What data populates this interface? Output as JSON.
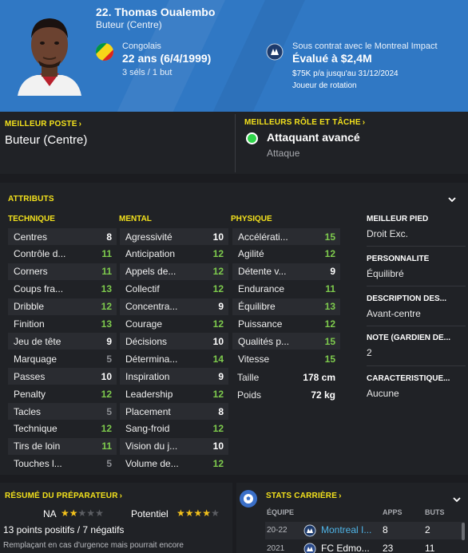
{
  "header": {
    "name": "22. Thomas Oualembo",
    "position": "Buteur (Centre)",
    "nationality": "Congolais",
    "age": "22 ans",
    "dob": "(6/4/1999)",
    "caps": "3 séls / 1 but",
    "contract": "Sous contrat avec le Montreal Impact",
    "value": "Évalué à $2,4M",
    "wage": "$75K p/a jusqu'au 31/12/2024",
    "squad_status": "Joueur de rotation"
  },
  "best_position": {
    "title": "MEILLEUR POSTE",
    "value": "Buteur (Centre)"
  },
  "best_role": {
    "title": "MEILLEURS RÔLE ET TÂCHE",
    "role": "Attaquant avancé",
    "duty": "Attaque",
    "indicator_color": "#2fd44a"
  },
  "attributes": {
    "title": "ATTRIBUTS",
    "technical_title": "TECHNIQUE",
    "mental_title": "MENTAL",
    "physical_title": "PHYSIQUE",
    "technical": [
      {
        "label": "Centres",
        "value": "8"
      },
      {
        "label": "Contrôle d...",
        "value": "11"
      },
      {
        "label": "Corners",
        "value": "11"
      },
      {
        "label": "Coups fra...",
        "value": "13"
      },
      {
        "label": "Dribble",
        "value": "12"
      },
      {
        "label": "Finition",
        "value": "13"
      },
      {
        "label": "Jeu de tête",
        "value": "9"
      },
      {
        "label": "Marquage",
        "value": "5"
      },
      {
        "label": "Passes",
        "value": "10"
      },
      {
        "label": "Penalty",
        "value": "12"
      },
      {
        "label": "Tacles",
        "value": "5"
      },
      {
        "label": "Technique",
        "value": "12"
      },
      {
        "label": "Tirs de loin",
        "value": "11"
      },
      {
        "label": "Touches l...",
        "value": "5"
      }
    ],
    "mental": [
      {
        "label": "Agressivité",
        "value": "10"
      },
      {
        "label": "Anticipation",
        "value": "12"
      },
      {
        "label": "Appels de...",
        "value": "12"
      },
      {
        "label": "Collectif",
        "value": "12"
      },
      {
        "label": "Concentra...",
        "value": "9"
      },
      {
        "label": "Courage",
        "value": "12"
      },
      {
        "label": "Décisions",
        "value": "10"
      },
      {
        "label": "Détermina...",
        "value": "14"
      },
      {
        "label": "Inspiration",
        "value": "9"
      },
      {
        "label": "Leadership",
        "value": "12"
      },
      {
        "label": "Placement",
        "value": "8"
      },
      {
        "label": "Sang-froid",
        "value": "12"
      },
      {
        "label": "Vision du j...",
        "value": "10"
      },
      {
        "label": "Volume de...",
        "value": "12"
      }
    ],
    "physical": [
      {
        "label": "Accélérati...",
        "value": "15"
      },
      {
        "label": "Agilité",
        "value": "12"
      },
      {
        "label": "Détente v...",
        "value": "9"
      },
      {
        "label": "Endurance",
        "value": "11"
      },
      {
        "label": "Équilibre",
        "value": "13"
      },
      {
        "label": "Puissance",
        "value": "12"
      },
      {
        "label": "Qualités p...",
        "value": "15"
      },
      {
        "label": "Vitesse",
        "value": "15"
      }
    ],
    "height_label": "Taille",
    "height": "178 cm",
    "weight_label": "Poids",
    "weight": "72 kg"
  },
  "info": {
    "foot_title": "MEILLEUR PIED",
    "foot": "Droit Exc.",
    "personality_title": "PERSONNALITÉ",
    "personality": "Équilibré",
    "description_title": "DESCRIPTION DES...",
    "description": "Avant-centre",
    "gk_title": "NOTE (GARDIEN DE...",
    "gk": "2",
    "traits_title": "CARACTÉRISTIQUE...",
    "traits": "Aucune"
  },
  "coach": {
    "title": "RÉSUMÉ DU PRÉPARATEUR",
    "na_label": "NA",
    "current_stars": 2,
    "potential_label": "Potentiel",
    "potential_stars": 4,
    "summary": "13 points positifs / 7 négatifs",
    "note": "Remplaçant en cas d'urgence mais pourrait encore"
  },
  "career": {
    "title": "STATS CARRIÈRE",
    "col_team": "ÉQUIPE",
    "col_apps": "APPS",
    "col_goals": "BUTS",
    "rows": [
      {
        "season": "20-22",
        "club": "Montreal I...",
        "apps": "8",
        "goals": "2"
      },
      {
        "season": "2021",
        "club": "FC Edmo...",
        "apps": "23",
        "goals": "11"
      }
    ]
  },
  "colors": {
    "header_blue": "#3078c4",
    "accent_yellow": "#f3e11c",
    "good_green": "#7ecb4d",
    "star_gold": "#f3c21c"
  }
}
